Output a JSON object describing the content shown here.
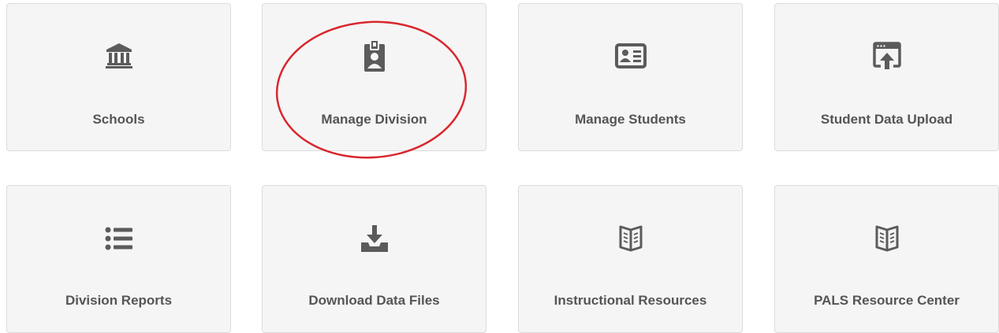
{
  "colors": {
    "tile_background": "#f5f5f5",
    "tile_border": "#dcdcdc",
    "icon": "#5b5b5b",
    "label": "#555555",
    "annotation_circle": "#d9272e"
  },
  "tiles": [
    {
      "label": "Schools",
      "icon": "bank-icon"
    },
    {
      "label": "Manage Division",
      "icon": "id-badge-icon"
    },
    {
      "label": "Manage Students",
      "icon": "id-card-icon"
    },
    {
      "label": "Student Data Upload",
      "icon": "upload-window-icon"
    },
    {
      "label": "Division Reports",
      "icon": "list-icon"
    },
    {
      "label": "Download Data Files",
      "icon": "download-tray-icon"
    },
    {
      "label": "Instructional Resources",
      "icon": "open-book-icon"
    },
    {
      "label": "PALS Resource Center",
      "icon": "open-book-icon"
    }
  ],
  "annotation": {
    "type": "red-circle",
    "highlighted_tile": "Manage Division"
  }
}
